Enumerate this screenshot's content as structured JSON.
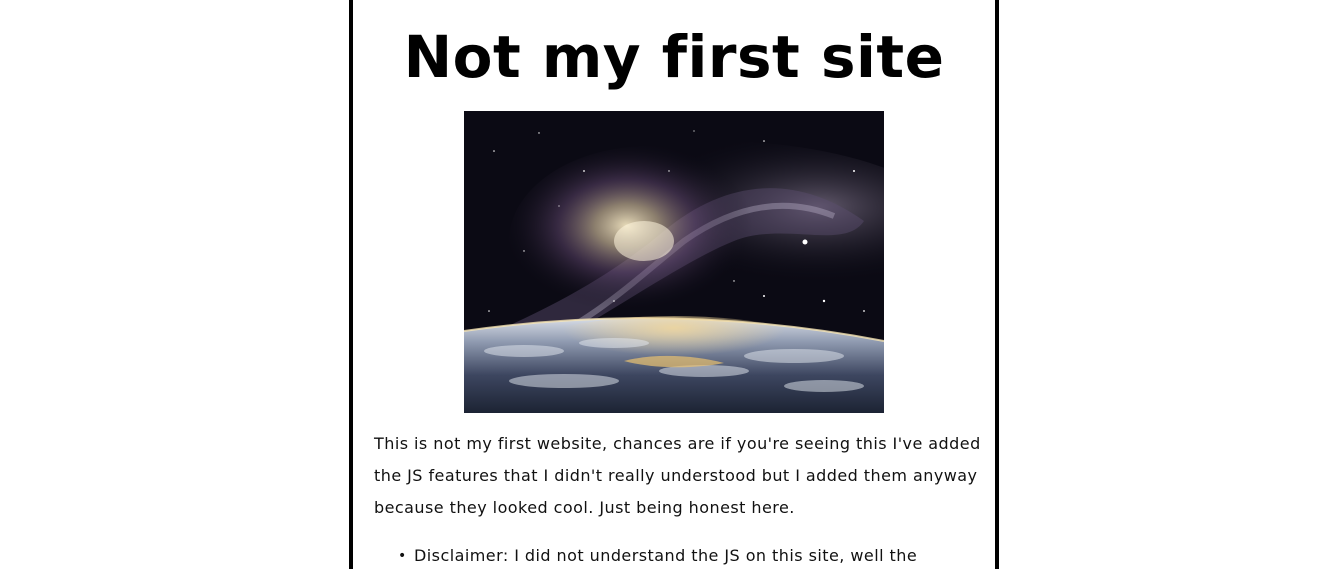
{
  "page": {
    "title": "Not my first site",
    "hero_image": {
      "subject": "galaxy-over-earth-horizon",
      "colors": {
        "space": "#0b0a14",
        "nebula_core": "#e8d8b0",
        "nebula_purple": "#6c4f7a",
        "sunrise": "#ffcf6a",
        "earth_clouds": "#b9c3d3",
        "earth_shadow": "#1c2333"
      }
    },
    "intro": "This is not my first website, chances are if you're seeing this I've added the JS features that I didn't really understood but I added them anyway because they looked cool. Just being honest here.",
    "notes": [
      "Disclaimer: I did not understand the JS on this site, well the"
    ]
  },
  "theme": {
    "border_color": "#000000",
    "background": "#ffffff",
    "text_color": "#111111"
  }
}
